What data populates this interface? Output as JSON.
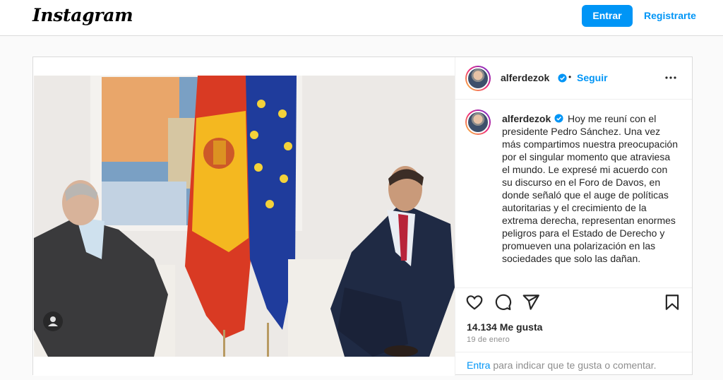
{
  "header": {
    "logo": "Instagram",
    "login_label": "Entrar",
    "signup_label": "Registrarte"
  },
  "post": {
    "username": "alferdezok",
    "separator": "•",
    "follow_label": "Seguir",
    "caption": "Hoy me reuní con el presidente Pedro Sánchez. Una vez más compartimos nuestra preocupación por el singular momento que atraviesa el mundo. Le expresé mi acuerdo con su discurso en el Foro de Davos, en donde señaló que el auge de políticas autoritarias y el crecimiento de la extrema derecha, representan enormes peligros para el Estado de Derecho y promueven una polarización en las sociedades que solo las dañan.",
    "likes": "14.134 Me gusta",
    "date": "19 de enero",
    "comment_prompt_link": "Entra",
    "comment_prompt_rest": " para indicar que te gusta o comentar."
  },
  "icons": [
    "verified-badge-icon",
    "more-options-icon",
    "heart-icon",
    "comment-icon",
    "share-icon",
    "bookmark-icon",
    "user-tag-icon"
  ],
  "colors": {
    "accent": "#0095f6",
    "text": "#262626",
    "muted": "#8e8e8e",
    "border": "#dbdbdb"
  }
}
